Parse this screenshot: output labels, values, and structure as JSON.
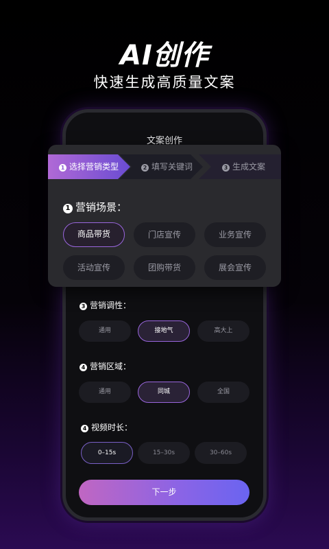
{
  "hero": {
    "title": "AI创作",
    "subtitle": "快速生成高质量文案"
  },
  "phone": {
    "title": "文案创作"
  },
  "steps": [
    {
      "num": "1",
      "label": "选择营销类型",
      "active": true
    },
    {
      "num": "2",
      "label": "填写关键词",
      "active": false
    },
    {
      "num": "3",
      "label": "生成文案",
      "active": false
    }
  ],
  "scene": {
    "num": "1",
    "label": "营销场景：",
    "options": [
      "商品带货",
      "门店宣传",
      "业务宣传",
      "活动宣传",
      "团购带货",
      "展会宣传"
    ],
    "selected": "商品带货"
  },
  "tone": {
    "num": "3",
    "label": "营销调性：",
    "options": [
      "通用",
      "接地气",
      "高大上"
    ],
    "selected": "接地气"
  },
  "region": {
    "num": "4",
    "label": "营销区域：",
    "options": [
      "通用",
      "同城",
      "全国"
    ],
    "selected": "同城"
  },
  "duration": {
    "num": "4",
    "label": "视频时长：",
    "options": [
      "0–15s",
      "15–30s",
      "30–60s"
    ],
    "selected": "0–15s"
  },
  "next_button": "下一步",
  "colors": {
    "accent_purple": "#9a66de",
    "gradient_start": "#c066c2",
    "gradient_end": "#6a64f0"
  }
}
